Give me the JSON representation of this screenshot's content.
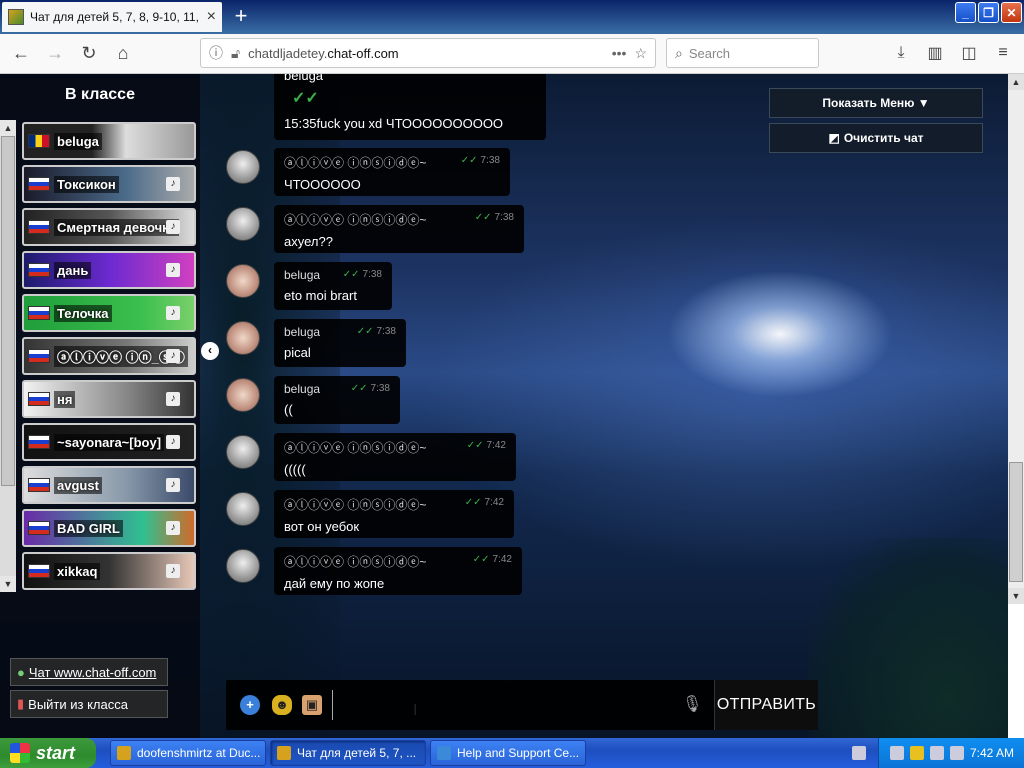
{
  "browser": {
    "tab_title": "Чат для детей 5, 7, 8, 9-10, 11, 12, 1...",
    "url_prefix": "chatdljadetey.",
    "url_domain": "chat-off.com",
    "search_placeholder": "Search"
  },
  "sidebar": {
    "title": "В классе",
    "users": [
      {
        "name": "beluga",
        "flag": "ro"
      },
      {
        "name": "Токсикон",
        "flag": "ru"
      },
      {
        "name": "Смертная девочка",
        "flag": "ru"
      },
      {
        "name": "дань",
        "flag": "ru"
      },
      {
        "name": "Телочка",
        "flag": "ru"
      },
      {
        "name": "ⓐⓛⓘⓥⓔ ⓘⓝ_ⓢⓘ",
        "flag": "ru"
      },
      {
        "name": "ня",
        "flag": "ru"
      },
      {
        "name": "~sayonara~[boy]",
        "flag": "ru"
      },
      {
        "name": "avgust",
        "flag": "ru"
      },
      {
        "name": "BAD GIRL",
        "flag": "ru"
      },
      {
        "name": "xikkaq",
        "flag": "ru"
      }
    ],
    "chat_link": "Чат www.chat-off.com",
    "exit_link": "Выйти из класса"
  },
  "chat": {
    "top_message": {
      "nick": "beluga",
      "text": "15:35fuck you xd ЧТОООООООООО"
    },
    "messages": [
      {
        "nick": "ⓐⓛⓘⓥⓔ ⓘⓝⓢⓘⓓⓔ~",
        "time": "7:38",
        "text": "ЧТООOOOO",
        "avatar": "face"
      },
      {
        "nick": "ⓐⓛⓘⓥⓔ ⓘⓝⓢⓘⓓⓔ~",
        "time": "7:38",
        "text": "ахуел??",
        "avatar": "face"
      },
      {
        "nick": "beluga",
        "time": "7:38",
        "text": "eto moi brart",
        "avatar": "cat"
      },
      {
        "nick": "beluga",
        "time": "7:38",
        "text": "pical",
        "avatar": "cat"
      },
      {
        "nick": "beluga",
        "time": "7:38",
        "text": "((",
        "avatar": "cat"
      },
      {
        "nick": "ⓐⓛⓘⓥⓔ ⓘⓝⓢⓘⓓⓔ~",
        "time": "7:42",
        "text": "(((((",
        "avatar": "face"
      },
      {
        "nick": "ⓐⓛⓘⓥⓔ ⓘⓝⓢⓘⓓⓔ~",
        "time": "7:42",
        "text": "вот он уебок",
        "avatar": "face"
      },
      {
        "nick": "ⓐⓛⓘⓥⓔ ⓘⓝⓢⓘⓓⓔ~",
        "time": "7:42",
        "text": "дай ему по жопе",
        "avatar": "face"
      }
    ]
  },
  "menu": {
    "show_menu": "Показать Меню ▼",
    "clear_chat": "Очистить чат"
  },
  "input": {
    "value": "",
    "send_label": "ОТПРАВИТЬ"
  },
  "taskbar": {
    "start_label": "start",
    "tasks": [
      {
        "label": "doofenshmirtz at Duc...",
        "active": false
      },
      {
        "label": "Чат для детей 5, 7, ...",
        "active": true
      },
      {
        "label": "Help and Support Ce...",
        "active": false
      }
    ],
    "clock": "7:42 AM"
  }
}
